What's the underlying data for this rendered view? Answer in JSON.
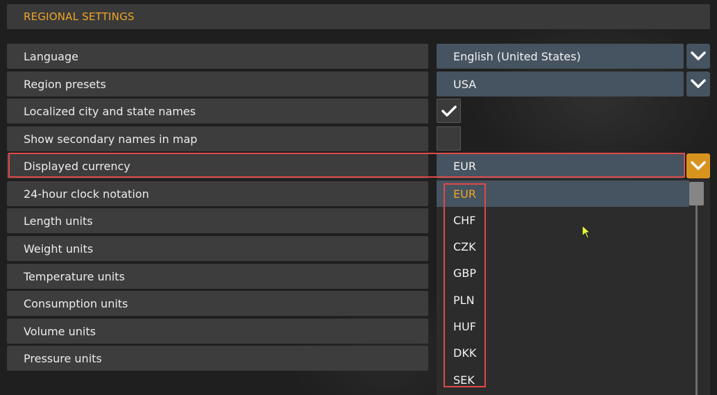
{
  "header": {
    "title": "REGIONAL SETTINGS"
  },
  "settings": [
    {
      "label": "Language",
      "value": "English (United States)"
    },
    {
      "label": "Region presets",
      "value": "USA"
    },
    {
      "label": "Localized city and state names",
      "checked": true
    },
    {
      "label": "Show secondary names in map",
      "checked": false
    },
    {
      "label": "Displayed currency",
      "value": "EUR"
    },
    {
      "label": "24-hour clock notation"
    },
    {
      "label": "Length units"
    },
    {
      "label": "Weight units"
    },
    {
      "label": "Temperature units"
    },
    {
      "label": "Consumption units"
    },
    {
      "label": "Volume units"
    },
    {
      "label": "Pressure units"
    }
  ],
  "currency_dropdown": {
    "options": [
      "EUR",
      "CHF",
      "CZK",
      "GBP",
      "PLN",
      "HUF",
      "DKK",
      "SEK"
    ],
    "selected": "EUR"
  },
  "icons": {
    "dropdown": "chevron-down-icon",
    "checkbox": "checkmark-icon"
  },
  "colors": {
    "accent": "#f0a526",
    "highlight": "#e04a4a",
    "value_bg": "#465360"
  }
}
